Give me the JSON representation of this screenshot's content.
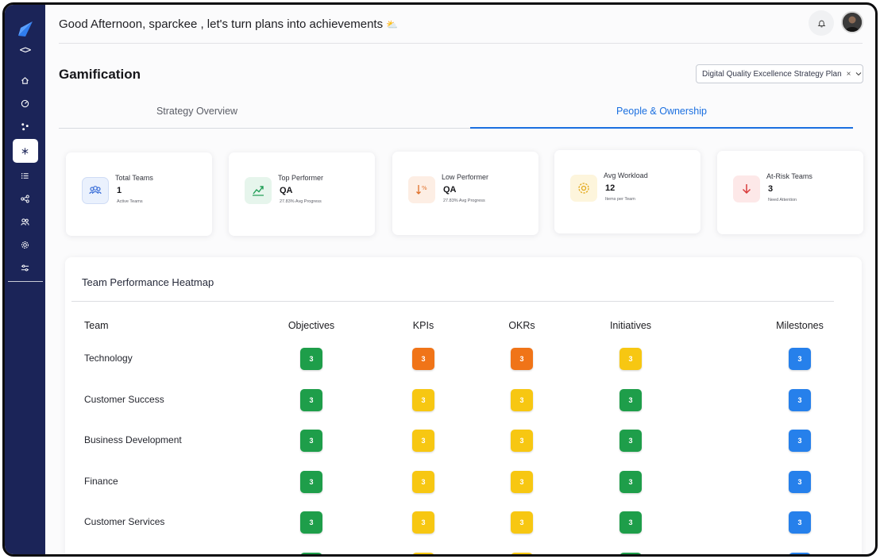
{
  "header": {
    "greeting": "Good Afternoon, sparckee , let's turn plans into achievements",
    "greeting_emoji": "⛅"
  },
  "sidebar": {
    "code_toggle": "<>",
    "items": [
      {
        "icon": "home-icon"
      },
      {
        "icon": "dashboard-icon"
      },
      {
        "icon": "nodes-icon"
      },
      {
        "icon": "asterisk-icon",
        "active": true
      },
      {
        "icon": "list-icon"
      },
      {
        "icon": "share-icon"
      },
      {
        "icon": "users-icon"
      },
      {
        "icon": "settings-icon"
      },
      {
        "icon": "sliders-icon"
      }
    ]
  },
  "page": {
    "title": "Gamification",
    "plan_select": {
      "value": "Digital Quality Excellence Strategy Plan",
      "clear": "×"
    }
  },
  "tabs": [
    {
      "label": "Strategy Overview",
      "active": false
    },
    {
      "label": "People & Ownership",
      "active": true
    }
  ],
  "cards": [
    {
      "label": "Total Teams",
      "value": "1",
      "sub": "Active Teams",
      "icon": "team-icon",
      "color": "#3b6fd8",
      "bg": "#eaf1fd"
    },
    {
      "label": "Top Performer",
      "value": "QA",
      "sub": "27.83% Avg Progress",
      "icon": "trend-up-icon",
      "color": "#1f9d55",
      "bg": "#e6f5ec"
    },
    {
      "label": "Low Performer",
      "value": "QA",
      "sub": "27.83% Avg Progress",
      "icon": "trend-down-icon",
      "color": "#e0702a",
      "bg": "#fdeee4"
    },
    {
      "label": "Avg Workload",
      "value": "12",
      "sub": "Items per Team",
      "icon": "gauge-icon",
      "color": "#e3a91b",
      "bg": "#fdf5dc"
    },
    {
      "label": "At-Risk Teams",
      "value": "3",
      "sub": "Need Attention",
      "icon": "arrow-down-icon",
      "color": "#d93a3a",
      "bg": "#fde8e8"
    }
  ],
  "heatmap": {
    "title": "Team Performance Heatmap",
    "columns": [
      "Team",
      "Objectives",
      "KPIs",
      "OKRs",
      "Initiatives",
      "Milestones"
    ],
    "colors": {
      "green": "#1e9e4a",
      "orange": "#f07418",
      "yellow": "#f7c712",
      "blue": "#2680eb"
    },
    "rows": [
      {
        "team": "Technology",
        "cells": [
          {
            "value": "3",
            "color": "green"
          },
          {
            "value": "3",
            "color": "orange"
          },
          {
            "value": "3",
            "color": "orange"
          },
          {
            "value": "3",
            "color": "yellow"
          },
          {
            "value": "3",
            "color": "blue"
          }
        ]
      },
      {
        "team": "Customer Success",
        "cells": [
          {
            "value": "3",
            "color": "green"
          },
          {
            "value": "3",
            "color": "yellow"
          },
          {
            "value": "3",
            "color": "yellow"
          },
          {
            "value": "3",
            "color": "green"
          },
          {
            "value": "3",
            "color": "blue"
          }
        ]
      },
      {
        "team": "Business Development",
        "cells": [
          {
            "value": "3",
            "color": "green"
          },
          {
            "value": "3",
            "color": "yellow"
          },
          {
            "value": "3",
            "color": "yellow"
          },
          {
            "value": "3",
            "color": "green"
          },
          {
            "value": "3",
            "color": "blue"
          }
        ]
      },
      {
        "team": "Finance",
        "cells": [
          {
            "value": "3",
            "color": "green"
          },
          {
            "value": "3",
            "color": "yellow"
          },
          {
            "value": "3",
            "color": "yellow"
          },
          {
            "value": "3",
            "color": "green"
          },
          {
            "value": "3",
            "color": "blue"
          }
        ]
      },
      {
        "team": "Customer Services",
        "cells": [
          {
            "value": "3",
            "color": "green"
          },
          {
            "value": "3",
            "color": "yellow"
          },
          {
            "value": "3",
            "color": "yellow"
          },
          {
            "value": "3",
            "color": "green"
          },
          {
            "value": "3",
            "color": "blue"
          }
        ]
      },
      {
        "team": "",
        "cells": [
          {
            "value": "",
            "color": "green"
          },
          {
            "value": "",
            "color": "yellow"
          },
          {
            "value": "",
            "color": "yellow"
          },
          {
            "value": "",
            "color": "green"
          },
          {
            "value": "",
            "color": "blue"
          }
        ]
      }
    ]
  }
}
